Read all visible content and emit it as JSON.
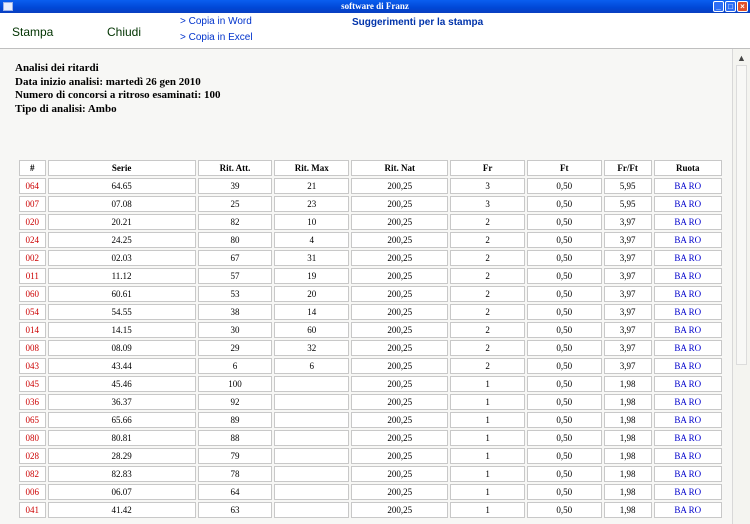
{
  "window": {
    "title": "software di Franz"
  },
  "toolbar": {
    "stampa": "Stampa",
    "chiudi": "Chiudi",
    "copia_word": "> Copia in Word",
    "copia_excel": "> Copia in Excel",
    "suggerimenti": "Suggerimenti per la stampa"
  },
  "report": {
    "line1": "Analisi dei ritardi",
    "line2": "Data inizio analisi: martedì 26 gen 2010",
    "line3": "Numero di concorsi a ritroso esaminati: 100",
    "line4": "Tipo di analisi: Ambo"
  },
  "table": {
    "headers": [
      "#",
      "Serie",
      "Rit. Att.",
      "Rit. Max",
      "Rit. Nat",
      "Fr",
      "Ft",
      "Fr/Ft",
      "Ruota"
    ],
    "rows": [
      [
        "064",
        "64.65",
        "39",
        "21",
        "200,25",
        "3",
        "0,50",
        "5,95",
        "BA RO"
      ],
      [
        "007",
        "07.08",
        "25",
        "23",
        "200,25",
        "3",
        "0,50",
        "5,95",
        "BA RO"
      ],
      [
        "020",
        "20.21",
        "82",
        "10",
        "200,25",
        "2",
        "0,50",
        "3,97",
        "BA RO"
      ],
      [
        "024",
        "24.25",
        "80",
        "4",
        "200,25",
        "2",
        "0,50",
        "3,97",
        "BA RO"
      ],
      [
        "002",
        "02.03",
        "67",
        "31",
        "200,25",
        "2",
        "0,50",
        "3,97",
        "BA RO"
      ],
      [
        "011",
        "11.12",
        "57",
        "19",
        "200,25",
        "2",
        "0,50",
        "3,97",
        "BA RO"
      ],
      [
        "060",
        "60.61",
        "53",
        "20",
        "200,25",
        "2",
        "0,50",
        "3,97",
        "BA RO"
      ],
      [
        "054",
        "54.55",
        "38",
        "14",
        "200,25",
        "2",
        "0,50",
        "3,97",
        "BA RO"
      ],
      [
        "014",
        "14.15",
        "30",
        "60",
        "200,25",
        "2",
        "0,50",
        "3,97",
        "BA RO"
      ],
      [
        "008",
        "08.09",
        "29",
        "32",
        "200,25",
        "2",
        "0,50",
        "3,97",
        "BA RO"
      ],
      [
        "043",
        "43.44",
        "6",
        "6",
        "200,25",
        "2",
        "0,50",
        "3,97",
        "BA RO"
      ],
      [
        "045",
        "45.46",
        "100",
        "",
        "200,25",
        "1",
        "0,50",
        "1,98",
        "BA RO"
      ],
      [
        "036",
        "36.37",
        "92",
        "",
        "200,25",
        "1",
        "0,50",
        "1,98",
        "BA RO"
      ],
      [
        "065",
        "65.66",
        "89",
        "",
        "200,25",
        "1",
        "0,50",
        "1,98",
        "BA RO"
      ],
      [
        "080",
        "80.81",
        "88",
        "",
        "200,25",
        "1",
        "0,50",
        "1,98",
        "BA RO"
      ],
      [
        "028",
        "28.29",
        "79",
        "",
        "200,25",
        "1",
        "0,50",
        "1,98",
        "BA RO"
      ],
      [
        "082",
        "82.83",
        "78",
        "",
        "200,25",
        "1",
        "0,50",
        "1,98",
        "BA RO"
      ],
      [
        "006",
        "06.07",
        "64",
        "",
        "200,25",
        "1",
        "0,50",
        "1,98",
        "BA RO"
      ],
      [
        "041",
        "41.42",
        "63",
        "",
        "200,25",
        "1",
        "0,50",
        "1,98",
        "BA RO"
      ]
    ]
  },
  "icons": {
    "scroll_up": "▲",
    "minimize": "_",
    "maximize": "□",
    "close": "×"
  },
  "colors": {
    "titlebar": "#0047d6",
    "row_number": "#cc0000",
    "ruota": "#0000cc",
    "link": "#0033cc"
  }
}
